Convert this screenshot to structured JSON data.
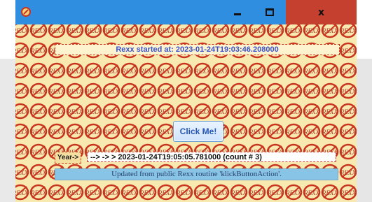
{
  "window": {
    "app_icon": "rexx-logo-icon",
    "controls": {
      "minimize_icon": "minimize-icon",
      "maximize_icon": "maximize-icon",
      "close_label": "x"
    }
  },
  "background": {
    "tile_word": "REXX",
    "tile_colors": {
      "ring": "#c8341e",
      "text": "#b3342a",
      "fill": "#f7e9b0"
    }
  },
  "client": {
    "started_text": "Rexx started at: 2023-01-24T19:03:46.208000",
    "click_button_label": "Click Me!",
    "year_label": "Year->",
    "year_value": "--> -> > 2023-01-24T19:05:05.781000 (count # 3)",
    "status_text": "Updated from public Rexx routine 'klickButtonAction'."
  },
  "colors": {
    "titlebar": "#2f8ee0",
    "close": "#c6402f",
    "accent_text": "#3b52c8",
    "status_bg": "#87c4e6"
  }
}
